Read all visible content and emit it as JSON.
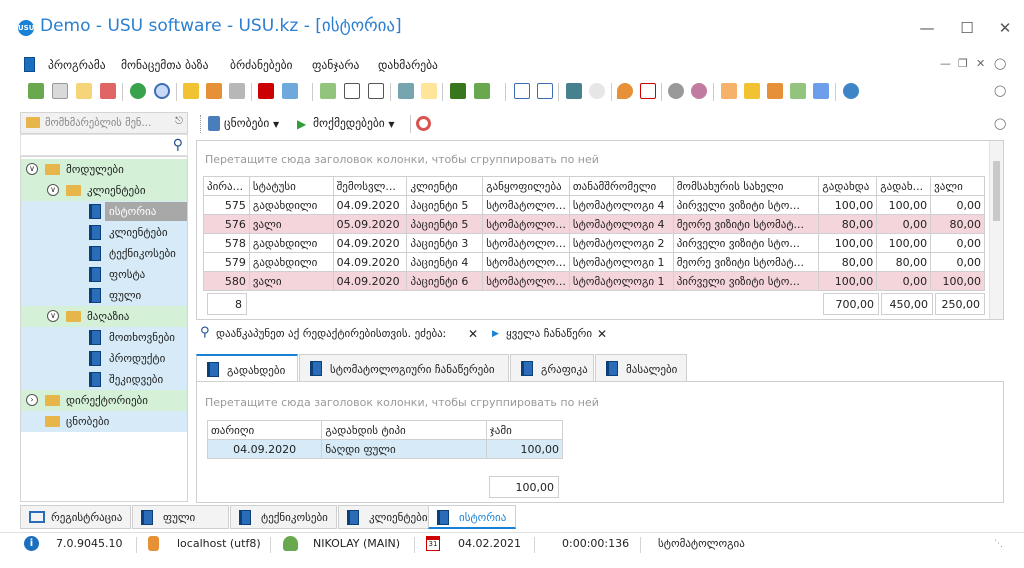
{
  "window": {
    "title": "Demo - USU software - USU.kz - [ისტორია]",
    "logo": "USU"
  },
  "menu": [
    "პროგრამა",
    "მონაცემთა ბაზა",
    "ბრძანებები",
    "ფანჯარა",
    "დახმარება"
  ],
  "nav": {
    "header": "მომხმარებლის მენ...",
    "tree": [
      {
        "label": "მოდულები",
        "level": 0,
        "kind": "folder"
      },
      {
        "label": "კლიენტები",
        "level": 1,
        "kind": "folder"
      },
      {
        "label": "ისტორია",
        "level": 2,
        "kind": "doc",
        "selected": true
      },
      {
        "label": "კლიენტები",
        "level": 2,
        "kind": "doc"
      },
      {
        "label": "ტექნიკოსები",
        "level": 2,
        "kind": "doc"
      },
      {
        "label": "ფოსტა",
        "level": 2,
        "kind": "doc"
      },
      {
        "label": "ფული",
        "level": 2,
        "kind": "doc"
      },
      {
        "label": "მაღაზია",
        "level": 1,
        "kind": "folder"
      },
      {
        "label": "მოთხოვნები",
        "level": 2,
        "kind": "doc"
      },
      {
        "label": "პროდუქტი",
        "level": 2,
        "kind": "doc"
      },
      {
        "label": "შეკიდვები",
        "level": 2,
        "kind": "doc"
      },
      {
        "label": "დირექტორიები",
        "level": 0,
        "kind": "folder"
      },
      {
        "label": "ცნობები",
        "level": 0,
        "kind": "folder"
      }
    ]
  },
  "right_toolbar": {
    "reports": "ცნობები",
    "actions": "მოქმედებები"
  },
  "main_grid": {
    "group_hint": "Перетащите сюда заголовок колонки, чтобы сгруппировать по ней",
    "columns": [
      "პირა...",
      "სტატუსი",
      "შემოსვლ...",
      "კლიენტი",
      "განყოფილება",
      "თანამშრომელი",
      "მომსახურის სახელი",
      "გადახდა",
      "გადახ...",
      "ვალი"
    ],
    "rows": [
      {
        "id": "575",
        "status": "გადახდილი",
        "date": "04.09.2020",
        "client": "პაციენტი 5",
        "dept": "სტომატოლო...",
        "employee": "სტომატოლოგი 4",
        "service": "პირველი ვიზიტი სტო...",
        "pay": "100,00",
        "paid": "100,00",
        "debt": "0,00",
        "style": "white"
      },
      {
        "id": "576",
        "status": "ვალი",
        "date": "05.09.2020",
        "client": "პაციენტი 5",
        "dept": "სტომატოლო...",
        "employee": "სტომატოლოგი 4",
        "service": "მეორე ვიზიტი სტომატ...",
        "pay": "80,00",
        "paid": "0,00",
        "debt": "80,00",
        "style": "red"
      },
      {
        "id": "578",
        "status": "გადახდილი",
        "date": "04.09.2020",
        "client": "პაციენტი 3",
        "dept": "სტომატოლო...",
        "employee": "სტომატოლოგი 2",
        "service": "პირველი ვიზიტი სტო...",
        "pay": "100,00",
        "paid": "100,00",
        "debt": "0,00",
        "style": "white"
      },
      {
        "id": "579",
        "status": "გადახდილი",
        "date": "04.09.2020",
        "client": "პაციენტი 4",
        "dept": "სტომატოლო...",
        "employee": "სტომატოლოგი 1",
        "service": "მეორე ვიზიტი სტომატ...",
        "pay": "80,00",
        "paid": "80,00",
        "debt": "0,00",
        "style": "white"
      },
      {
        "id": "580",
        "status": "ვალი",
        "date": "04.09.2020",
        "client": "პაციენტი 6",
        "dept": "სტომატოლო...",
        "employee": "სტომატოლოგი 1",
        "service": "პირველი ვიზიტი სტო...",
        "pay": "100,00",
        "paid": "0,00",
        "debt": "100,00",
        "style": "red"
      }
    ],
    "footer": {
      "count": "8",
      "pay": "700,00",
      "paid": "450,00",
      "debt": "250,00"
    }
  },
  "filter": {
    "hint": "დააწკაპუნეთ აქ რედაქტირებისთვის. ეძებაː",
    "all_records": "ყველა ჩანაწერი"
  },
  "subtabs": [
    {
      "label": "გადახდები",
      "active": true
    },
    {
      "label": "სტომატოლოგიური ჩანაწერები"
    },
    {
      "label": "გრაფიკა"
    },
    {
      "label": "მასალები"
    }
  ],
  "sub_grid": {
    "group_hint": "Перетащите сюда заголовок колонки, чтобы сгруппировать по ней",
    "columns": [
      "თარიღი",
      "გადახდის ტიპი",
      "ჯამი"
    ],
    "rows": [
      {
        "date": "04.09.2020",
        "type": "ნაღდი ფული",
        "sum": "100,00"
      }
    ],
    "total": "100,00"
  },
  "bottom_tabs": [
    {
      "label": "რეგისტრაცია"
    },
    {
      "label": "ფული"
    },
    {
      "label": "ტექნიკოსები"
    },
    {
      "label": "კლიენტები"
    },
    {
      "label": "ისტორია",
      "active": true
    }
  ],
  "status": {
    "version": "7.0.9045.10",
    "db": "localhost (utf8)",
    "user": "NIKOLAY (MAIN)",
    "date": "04.02.2021",
    "timer": "0:00:00:136",
    "module": "სტომატოლოგია"
  }
}
